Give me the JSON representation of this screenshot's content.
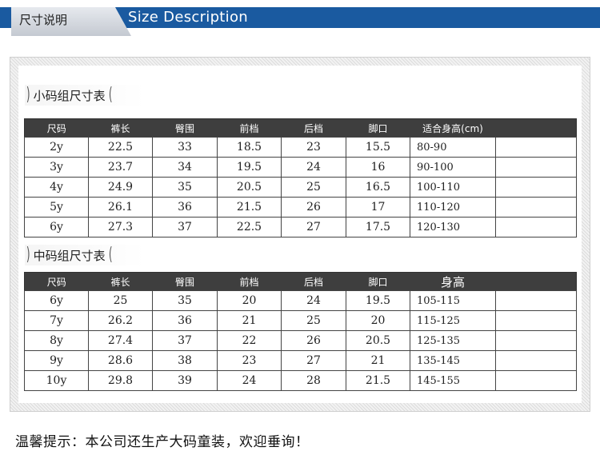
{
  "header": {
    "title_cn": "尺寸说明",
    "title_en": "Size Description",
    "bar_color": "#1a5aa0"
  },
  "small_group": {
    "label": "小码组尺寸表",
    "columns": [
      "尺码",
      "裤长",
      "臀围",
      "前档",
      "后档",
      "脚口",
      "适合身高(cm)",
      ""
    ],
    "rows": [
      [
        "2y",
        "22.5",
        "33",
        "18.5",
        "23",
        "15.5",
        "80-90",
        ""
      ],
      [
        "3y",
        "23.7",
        "34",
        "19.5",
        "24",
        "16",
        "90-100",
        ""
      ],
      [
        "4y",
        "24.9",
        "35",
        "20.5",
        "25",
        "16.5",
        "100-110",
        ""
      ],
      [
        "5y",
        "26.1",
        "36",
        "21.5",
        "26",
        "17",
        "110-120",
        ""
      ],
      [
        "6y",
        "27.3",
        "37",
        "22.5",
        "27",
        "17.5",
        "120-130",
        ""
      ]
    ]
  },
  "medium_group": {
    "label": "中码组尺寸表",
    "columns": [
      "尺码",
      "裤长",
      "臀围",
      "前档",
      "后档",
      "脚口",
      "身高",
      ""
    ],
    "rows": [
      [
        "6y",
        "25",
        "35",
        "20",
        "24",
        "19.5",
        "105-115",
        ""
      ],
      [
        "7y",
        "26.2",
        "36",
        "21",
        "25",
        "20",
        "115-125",
        ""
      ],
      [
        "8y",
        "27.4",
        "37",
        "22",
        "26",
        "20.5",
        "125-135",
        ""
      ],
      [
        "9y",
        "28.6",
        "38",
        "23",
        "27",
        "21",
        "135-145",
        ""
      ],
      [
        "10y",
        "29.8",
        "39",
        "24",
        "28",
        "21.5",
        "145-155",
        ""
      ]
    ]
  },
  "footer": {
    "note": "温馨提示：本公司还生产大码童装，欢迎垂询！"
  }
}
